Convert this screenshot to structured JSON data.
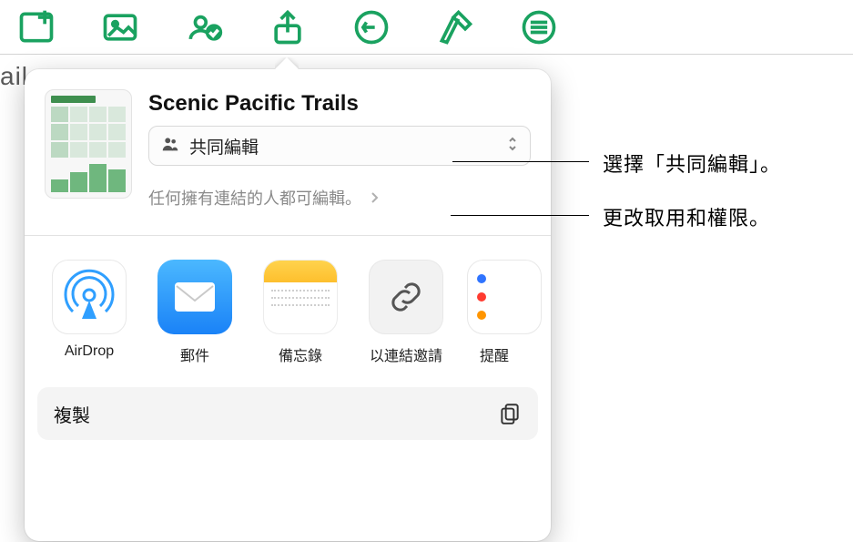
{
  "toolbar": {
    "icons": [
      "add-sheet-icon",
      "photo-icon",
      "collaborate-icon",
      "share-icon",
      "undo-icon",
      "format-icon",
      "more-icon"
    ]
  },
  "bg_tab_fragment": "ail",
  "share": {
    "doc_title": "Scenic Pacific Trails",
    "collab_mode_label": "共同編輯",
    "permissions_text": "任何擁有連結的人都可編輯。",
    "apps": [
      {
        "id": "airdrop",
        "label": "AirDrop"
      },
      {
        "id": "mail",
        "label": "郵件"
      },
      {
        "id": "notes",
        "label": "備忘錄"
      },
      {
        "id": "invite-link",
        "label": "以連結邀請"
      },
      {
        "id": "reminders",
        "label": "提醒"
      }
    ],
    "actions": {
      "copy_label": "複製"
    }
  },
  "callouts": {
    "collab": "選擇「共同編輯」。",
    "permissions": "更改取用和權限。"
  }
}
